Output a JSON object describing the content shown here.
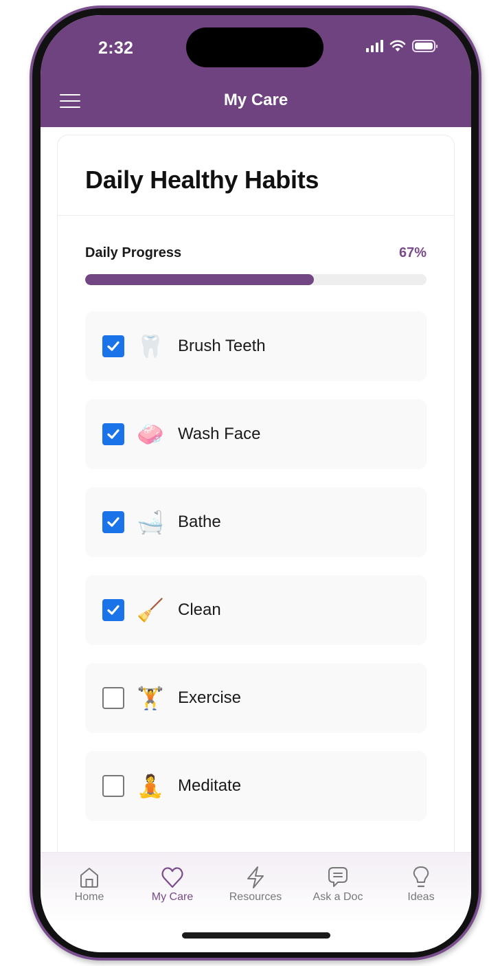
{
  "status_bar": {
    "time": "2:32"
  },
  "header": {
    "title": "My Care",
    "menu_icon": "hamburger-icon"
  },
  "card": {
    "title": "Daily Healthy Habits",
    "progress": {
      "label": "Daily Progress",
      "value_text": "67%",
      "fraction": 0.67
    },
    "habits": [
      {
        "name": "Brush Teeth",
        "emoji": "🦷",
        "icon": "tooth-icon",
        "checked": true
      },
      {
        "name": "Wash Face",
        "emoji": "🧼",
        "icon": "soap-icon",
        "checked": true
      },
      {
        "name": "Bathe",
        "emoji": "🛁",
        "icon": "bathtub-icon",
        "checked": true
      },
      {
        "name": "Clean",
        "emoji": "🧹",
        "icon": "broom-icon",
        "checked": true
      },
      {
        "name": "Exercise",
        "emoji": "🏋️",
        "icon": "weightlifter-icon",
        "checked": false
      },
      {
        "name": "Meditate",
        "emoji": "🧘",
        "icon": "meditation-icon",
        "checked": false
      }
    ]
  },
  "tabbar": {
    "items": [
      {
        "label": "Home",
        "icon": "home-icon",
        "active": false
      },
      {
        "label": "My Care",
        "icon": "heart-icon",
        "active": true
      },
      {
        "label": "Resources",
        "icon": "lightning-icon",
        "active": false
      },
      {
        "label": "Ask a Doc",
        "icon": "chat-icon",
        "active": false
      },
      {
        "label": "Ideas",
        "icon": "lightbulb-icon",
        "active": false
      }
    ]
  },
  "colors": {
    "brand": "#6f4380",
    "progress_fill": "#724682",
    "checkbox_checked": "#1a73e8",
    "active_tab": "#7a4a8a"
  }
}
